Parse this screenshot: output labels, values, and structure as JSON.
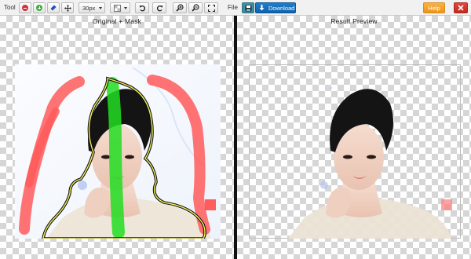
{
  "toolbar": {
    "tool_label": "Tool",
    "brush_size": "30px",
    "file_label": "File",
    "download_label": "Download",
    "help_label": "Help",
    "icons": [
      "remove-icon",
      "add-icon",
      "eraser-icon",
      "move-icon",
      "size-dropdown",
      "color-dropdown",
      "undo-icon",
      "redo-icon",
      "zoom-in-icon",
      "zoom-out-icon",
      "fullscreen-icon",
      "save-icon",
      "download-icon",
      "close-icon"
    ]
  },
  "left_pane": {
    "title": "Original + Mask"
  },
  "right_pane": {
    "title": "Result Preview"
  },
  "colors": {
    "toolbar_bg": "#f1f1f1",
    "remove_red": "#d8303a",
    "add_green": "#3fae3f",
    "mask_red": "#ff5a5a",
    "mask_green": "#22dd22",
    "outline_yellow": "#f1ef57",
    "download_blue": "#1a72c0",
    "help_orange": "#f0a030",
    "close_red": "#d43a2f",
    "save_teal": "#3d8fa2",
    "divider": "#111111"
  }
}
